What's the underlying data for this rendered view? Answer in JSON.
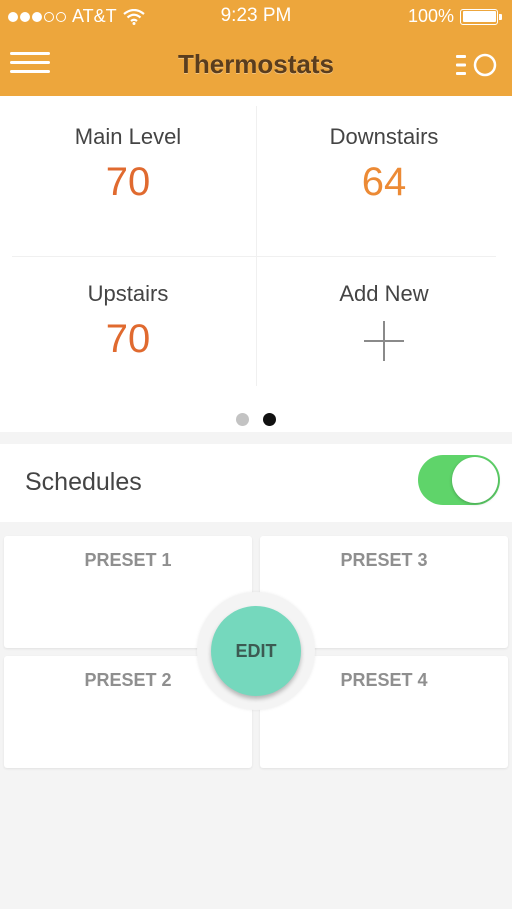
{
  "status_bar": {
    "carrier": "AT&T",
    "time": "9:23 PM",
    "battery": "100%",
    "signal_bars_filled": 3,
    "signal_bars_total": 5
  },
  "nav": {
    "title": "Thermostats",
    "menu_icon": "hamburger-menu-icon",
    "list_icon": "list-toggle-icon"
  },
  "thermostats": [
    {
      "name": "Main Level",
      "temp": "70"
    },
    {
      "name": "Downstairs",
      "temp": "64"
    },
    {
      "name": "Upstairs",
      "temp": "70"
    }
  ],
  "add_new": {
    "label": "Add New",
    "icon": "plus-icon"
  },
  "pager": {
    "pages": 2,
    "current": 2
  },
  "schedules": {
    "label": "Schedules",
    "enabled": true
  },
  "presets": [
    {
      "label": "PRESET 1"
    },
    {
      "label": "PRESET 2"
    },
    {
      "label": "PRESET 3"
    },
    {
      "label": "PRESET 4"
    }
  ],
  "edit_button": {
    "label": "EDIT"
  },
  "colors": {
    "header": "#eda63c",
    "temp": "#e06a2f",
    "toggle_on": "#5fd46a",
    "edit": "#75d8bd"
  }
}
